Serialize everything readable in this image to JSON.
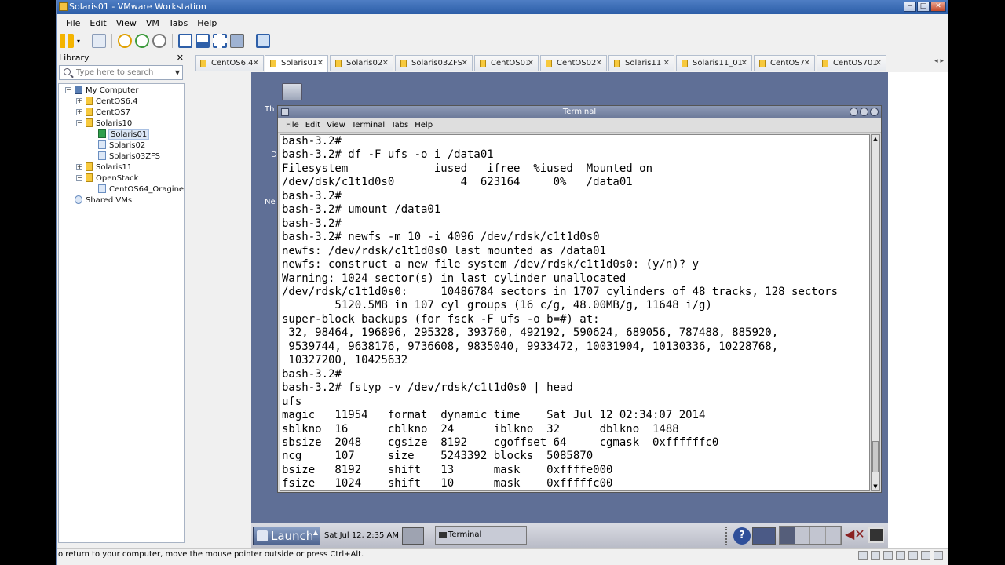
{
  "window": {
    "title": "Solaris01 - VMware Workstation",
    "buttons": {
      "minimize": "−",
      "maximize": "□",
      "close": "✕"
    }
  },
  "menubar": [
    "File",
    "Edit",
    "View",
    "VM",
    "Tabs",
    "Help"
  ],
  "toolbar_icons": [
    "pause-icon",
    "snapshot-icon",
    "revert-icon",
    "manage-snapshots-icon",
    "normal-view-icon",
    "quick-switch-icon",
    "fullscreen-icon",
    "unity-icon",
    "console-view-icon"
  ],
  "library": {
    "title": "Library",
    "close": "✕",
    "search_placeholder": "Type here to search",
    "tree": [
      {
        "label": "My Computer",
        "expander": "−",
        "icon": "pc"
      },
      {
        "label": "CentOS6.4",
        "expander": "+",
        "icon": "folder"
      },
      {
        "label": "CentOS7",
        "expander": "+",
        "icon": "folder"
      },
      {
        "label": "Solaris10",
        "expander": "−",
        "icon": "folder"
      },
      {
        "label": "Solaris01",
        "icon": "vm-running",
        "selected": true
      },
      {
        "label": "Solaris02",
        "icon": "vm"
      },
      {
        "label": "Solaris03ZFS",
        "icon": "vm"
      },
      {
        "label": "Solaris11",
        "expander": "+",
        "icon": "folder"
      },
      {
        "label": "OpenStack",
        "expander": "−",
        "icon": "folder"
      },
      {
        "label": "CentOS64_Oragine",
        "icon": "vm"
      },
      {
        "label": "Shared VMs",
        "icon": "shared"
      }
    ]
  },
  "tabs": [
    {
      "label": "CentOS6.4",
      "close": "✕"
    },
    {
      "label": "Solaris01",
      "close": "✕",
      "active": true
    },
    {
      "label": "Solaris02",
      "close": "✕"
    },
    {
      "label": "Solaris03ZFS",
      "close": "✕"
    },
    {
      "label": "CentOS01",
      "close": "✕"
    },
    {
      "label": "CentOS02",
      "close": "✕"
    },
    {
      "label": "Solaris11",
      "close": "✕"
    },
    {
      "label": "Solaris11_01",
      "close": "✕"
    },
    {
      "label": "CentOS7",
      "close": "✕"
    },
    {
      "label": "CentOS701",
      "close": "✕"
    }
  ],
  "tab_nav": "◂ ▸",
  "guest": {
    "desktop_labels": [
      "Th",
      "D",
      "Ne"
    ],
    "terminal": {
      "title": "Terminal",
      "menu": [
        "File",
        "Edit",
        "View",
        "Terminal",
        "Tabs",
        "Help"
      ],
      "lines": [
        "bash-3.2#",
        "bash-3.2# df -F ufs -o i /data01",
        "Filesystem             iused   ifree  %iused  Mounted on",
        "/dev/dsk/c1t1d0s0          4  623164     0%   /data01",
        "bash-3.2#",
        "bash-3.2# umount /data01",
        "bash-3.2#",
        "bash-3.2# newfs -m 10 -i 4096 /dev/rdsk/c1t1d0s0",
        "newfs: /dev/rdsk/c1t1d0s0 last mounted as /data01",
        "newfs: construct a new file system /dev/rdsk/c1t1d0s0: (y/n)? y",
        "Warning: 1024 sector(s) in last cylinder unallocated",
        "/dev/rdsk/c1t1d0s0:     10486784 sectors in 1707 cylinders of 48 tracks, 128 sectors",
        "        5120.5MB in 107 cyl groups (16 c/g, 48.00MB/g, 11648 i/g)",
        "super-block backups (for fsck -F ufs -o b=#) at:",
        " 32, 98464, 196896, 295328, 393760, 492192, 590624, 689056, 787488, 885920,",
        " 9539744, 9638176, 9736608, 9835040, 9933472, 10031904, 10130336, 10228768,",
        " 10327200, 10425632",
        "bash-3.2#",
        "bash-3.2# fstyp -v /dev/rdsk/c1t1d0s0 | head",
        "ufs",
        "magic   11954   format  dynamic time    Sat Jul 12 02:34:07 2014",
        "sblkno  16      cblkno  24      iblkno  32      dblkno  1488",
        "sbsize  2048    cgsize  8192    cgoffset 64     cgmask  0xffffffc0",
        "ncg     107     size    5243392 blocks  5085870",
        "bsize   8192    shift   13      mask    0xffffe000",
        "fsize   1024    shift   10      mask    0xfffffc00"
      ]
    },
    "panel": {
      "launch": "Launch",
      "clock": "Sat Jul 12,  2:35 AM",
      "task": "Terminal",
      "help": "?"
    }
  },
  "statusbar": {
    "text": "o return to your computer, move the mouse pointer outside or press Ctrl+Alt."
  },
  "colors": {
    "title_bar": "#2c5ea8",
    "guest_desktop": "#5f6f96",
    "terminal_bg": "#ffffff"
  }
}
